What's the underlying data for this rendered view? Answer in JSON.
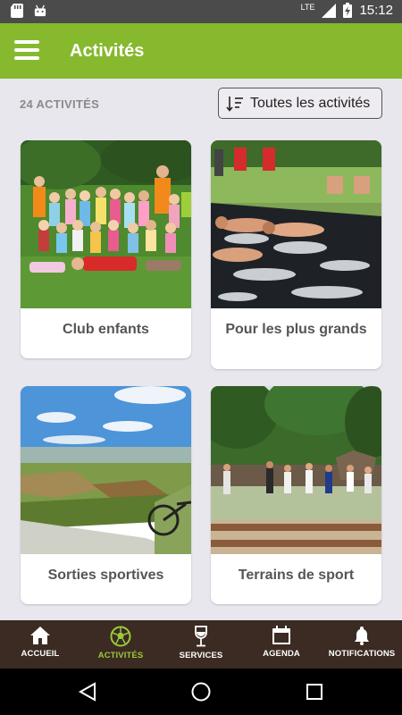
{
  "status": {
    "time": "15:12",
    "network": "LTE"
  },
  "header": {
    "title": "Activités"
  },
  "toolbar": {
    "count_label": "24 ACTIVITÉS",
    "filter_label": "Toutes les activités"
  },
  "cards": [
    {
      "title": "Club enfants"
    },
    {
      "title": "Pour les plus grands"
    },
    {
      "title": "Sorties sportives"
    },
    {
      "title": "Terrains de sport"
    }
  ],
  "nav": {
    "items": [
      {
        "label": "ACCUEIL",
        "icon": "home-icon"
      },
      {
        "label": "ACTIVITÉS",
        "icon": "soccer-ball-icon",
        "active": true
      },
      {
        "label": "SERVICES",
        "icon": "wine-glass-icon"
      },
      {
        "label": "AGENDA",
        "icon": "calendar-icon"
      },
      {
        "label": "NOTIFICATIONS",
        "icon": "bell-icon"
      }
    ]
  },
  "colors": {
    "accent": "#86b92e",
    "active_tab": "#9cc93a",
    "bottom_bar": "#3b2b22",
    "status_bar": "#4b4b4b"
  }
}
